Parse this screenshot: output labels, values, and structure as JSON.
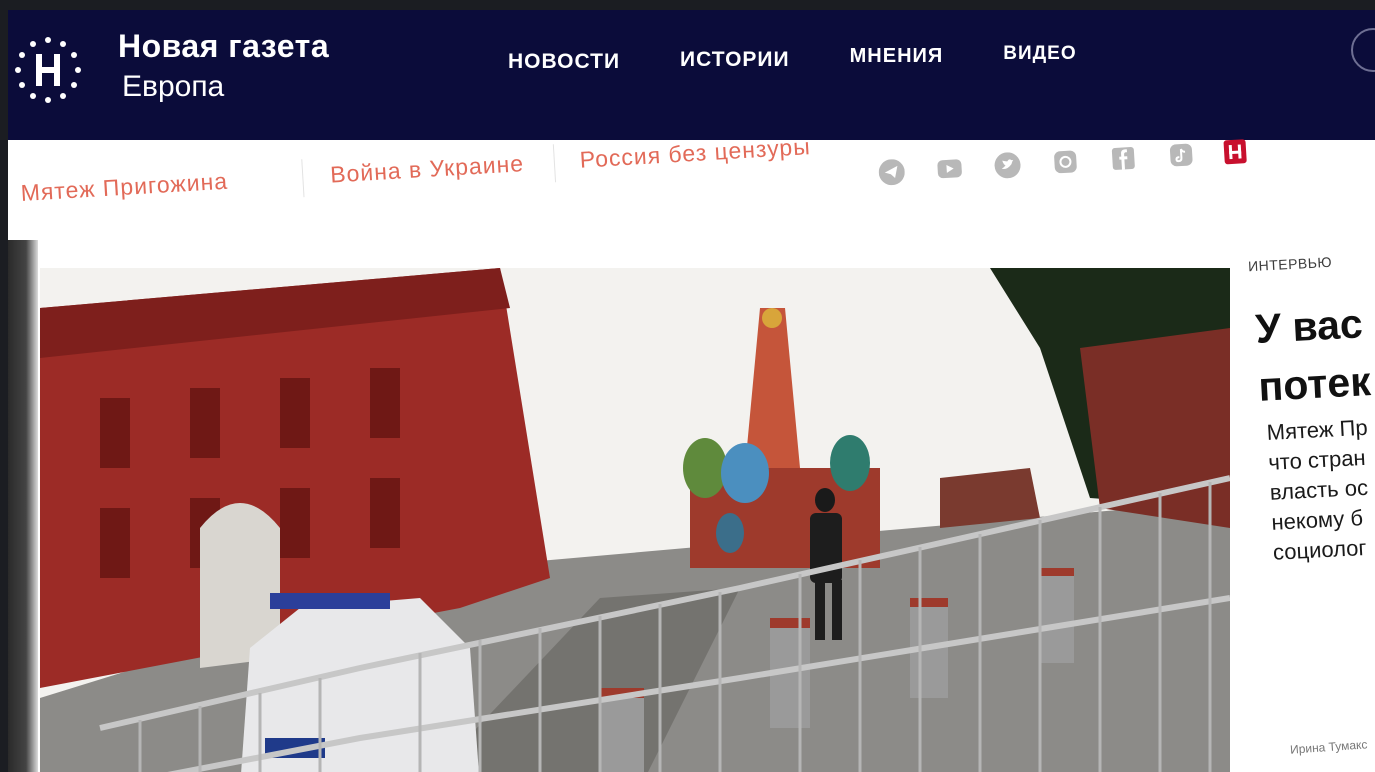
{
  "header": {
    "logo_line1": "Новая газета",
    "logo_line2": "Европа",
    "nav": [
      "НОВОСТИ",
      "ИСТОРИИ",
      "МНЕНИЯ",
      "ВИДЕО"
    ]
  },
  "topics": [
    "Мятеж Пригожина",
    "Война в Украине",
    "Россия без цензуры"
  ],
  "socials": [
    "telegram-icon",
    "youtube-icon",
    "twitter-icon",
    "instagram-icon",
    "facebook-icon",
    "tiktok-icon",
    "novaya-gazeta-icon"
  ],
  "colors": {
    "header_bg": "#0b0c3a",
    "topic_accent": "#e26a58",
    "brand_red": "#c8102e"
  },
  "hero": {
    "image": "photo-red-square-barrier"
  },
  "side_article": {
    "tag": "ИНТЕРВЬЮ",
    "headline_line1": "У вас с",
    "headline_line2": "потек",
    "lead_lines": [
      "Мятеж Пр",
      "что стран",
      "власть ос",
      "некому б",
      "социолог"
    ],
    "author": "Ирина Тумакс"
  }
}
